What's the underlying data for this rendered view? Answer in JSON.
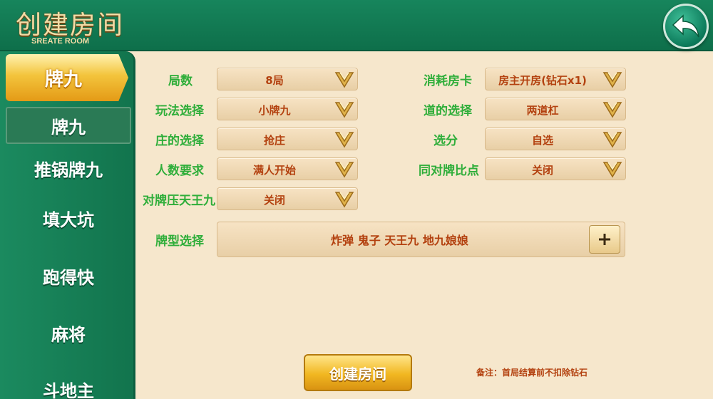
{
  "header": {
    "title": "创建房间",
    "subtitle": "SREATE ROOM",
    "back_icon": "back-arrow-icon"
  },
  "sidebar": {
    "active_tab": "牌九",
    "items": [
      {
        "label": "牌九",
        "selected": true
      },
      {
        "label": "推锅牌九",
        "selected": false
      },
      {
        "label": "填大坑",
        "selected": false
      },
      {
        "label": "跑得快",
        "selected": false
      },
      {
        "label": "麻将",
        "selected": false
      },
      {
        "label": "斗地主",
        "selected": false
      }
    ]
  },
  "form": {
    "rounds": {
      "label": "局数",
      "value": "8局"
    },
    "room_card": {
      "label": "消耗房卡",
      "value": "房主开房(钻石x1)"
    },
    "play_mode": {
      "label": "玩法选择",
      "value": "小牌九"
    },
    "lanes": {
      "label": "道的选择",
      "value": "两道杠"
    },
    "banker": {
      "label": "庄的选择",
      "value": "抢庄"
    },
    "score": {
      "label": "选分",
      "value": "自选"
    },
    "players": {
      "label": "人数要求",
      "value": "满人开始"
    },
    "pair_compare": {
      "label": "同对牌比点",
      "value": "关闭"
    },
    "pair_over": {
      "label": "对牌压天王九",
      "value": "关闭"
    },
    "card_types": {
      "label": "牌型选择",
      "value": "炸弹 鬼子 天王九 地九娘娘"
    }
  },
  "actions": {
    "create_label": "创建房间",
    "note": "备注：首局结算前不扣除钻石"
  },
  "colors": {
    "header_green": "#17855c",
    "label_green": "#2fae3a",
    "value_orange": "#b3410f",
    "gold": "#f1b721"
  }
}
